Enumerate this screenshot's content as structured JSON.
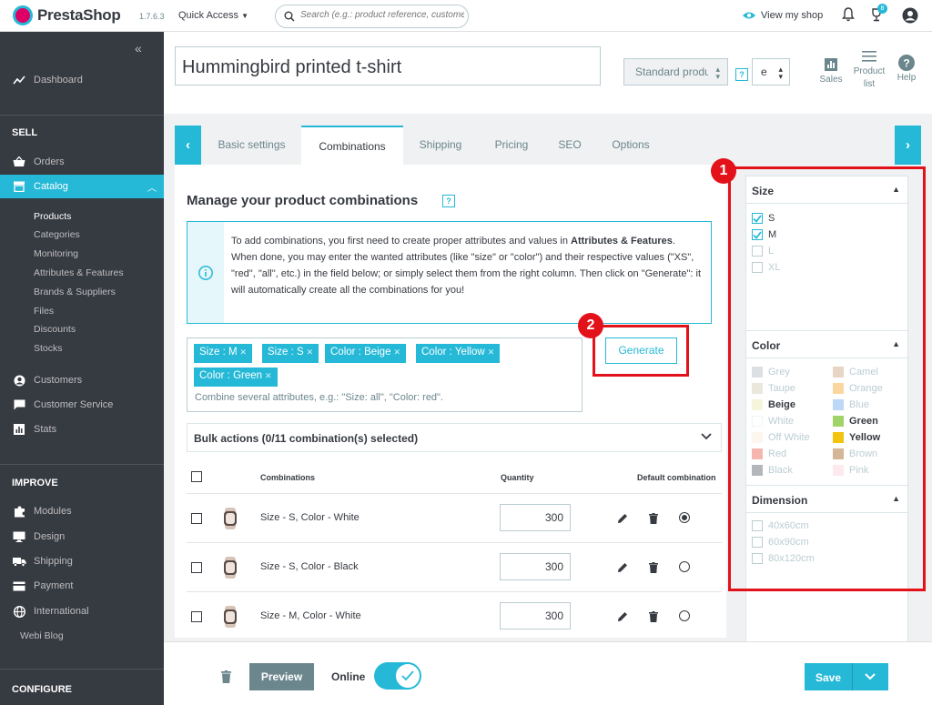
{
  "header": {
    "logo_text": "PrestaShop",
    "version": "1.7.6.3",
    "quick_access": "Quick Access",
    "search_placeholder": "Search (e.g.: product reference, customer name…)",
    "view_shop": "View my shop",
    "notification_count": "8"
  },
  "sidebar": {
    "dashboard": "Dashboard",
    "section_sell": "SELL",
    "orders": "Orders",
    "catalog": "Catalog",
    "catalog_sub": [
      "Products",
      "Categories",
      "Monitoring",
      "Attributes & Features",
      "Brands & Suppliers",
      "Files",
      "Discounts",
      "Stocks"
    ],
    "customers": "Customers",
    "customer_service": "Customer Service",
    "stats": "Stats",
    "section_improve": "IMPROVE",
    "modules": "Modules",
    "design": "Design",
    "shipping": "Shipping",
    "payment": "Payment",
    "international": "International",
    "webi_blog": "Webi Blog",
    "section_configure": "CONFIGURE"
  },
  "toolbar": {
    "product_name": "Hummingbird printed t-shirt",
    "product_type": "Standard product",
    "lang": "e",
    "sales": "Sales",
    "product_list_1": "Product",
    "product_list_2": "list",
    "help": "Help",
    "help_mark": "?"
  },
  "tabs": [
    "Basic settings",
    "Combinations",
    "Shipping",
    "Pricing",
    "SEO",
    "Options"
  ],
  "combinations": {
    "title": "Manage your product combinations",
    "info_line1_a": "To add combinations, you first need to create proper attributes and values in ",
    "info_line1_b": "Attributes & Features",
    "info_line1_c": ".",
    "info_line2": "When done, you may enter the wanted attributes (like \"size\" or \"color\") and their respective values (\"XS\", \"red\", \"all\", etc.) in the field below; or simply select them from the right column. Then click on \"Generate\": it will automatically create all the combinations for you!",
    "tags": [
      "Size : M",
      "Size : S",
      "Color : Beige",
      "Color : Yellow",
      "Color : Green"
    ],
    "tag_placeholder": "Combine several attributes, e.g.: \"Size: all\", \"Color: red\".",
    "generate": "Generate",
    "bulk": "Bulk actions (0/11 combination(s) selected)",
    "col_combinations": "Combinations",
    "col_quantity": "Quantity",
    "col_default": "Default combination",
    "rows": [
      {
        "name": "Size - S, Color - White",
        "qty": "300"
      },
      {
        "name": "Size - S, Color - Black",
        "qty": "300"
      },
      {
        "name": "Size - M, Color - White",
        "qty": "300"
      }
    ]
  },
  "filters": {
    "size_title": "Size",
    "sizes": [
      {
        "label": "S",
        "checked": true
      },
      {
        "label": "M",
        "checked": true
      },
      {
        "label": "L",
        "checked": false
      },
      {
        "label": "XL",
        "checked": false
      }
    ],
    "color_title": "Color",
    "colors_left": [
      {
        "label": "Grey",
        "hex": "#aab2bd",
        "selected": false
      },
      {
        "label": "Taupe",
        "hex": "#cfc4a6",
        "selected": false
      },
      {
        "label": "Beige",
        "hex": "#f5f5dc",
        "selected": true
      },
      {
        "label": "White",
        "hex": "#ffffff",
        "selected": false
      },
      {
        "label": "Off White",
        "hex": "#faebd7",
        "selected": false
      },
      {
        "label": "Red",
        "hex": "#e84c3d",
        "selected": false
      },
      {
        "label": "Black",
        "hex": "#434a54",
        "selected": false
      }
    ],
    "colors_right": [
      {
        "label": "Camel",
        "hex": "#c19a6b",
        "selected": false
      },
      {
        "label": "Orange",
        "hex": "#f39c11",
        "selected": false
      },
      {
        "label": "Blue",
        "hex": "#5d9cec",
        "selected": false
      },
      {
        "label": "Green",
        "hex": "#a0d468",
        "selected": true
      },
      {
        "label": "Yellow",
        "hex": "#f1c40f",
        "selected": true
      },
      {
        "label": "Brown",
        "hex": "#964b00",
        "selected": false
      },
      {
        "label": "Pink",
        "hex": "#fcccd9",
        "selected": false
      }
    ],
    "dimension_title": "Dimension",
    "dimensions": [
      "40x60cm",
      "60x90cm",
      "80x120cm"
    ]
  },
  "annotations": {
    "badge1": "1",
    "badge2": "2"
  },
  "footer": {
    "preview": "Preview",
    "online": "Online",
    "save": "Save"
  },
  "colors": {
    "accent": "#25b9d7",
    "sidebar": "#363a41",
    "annotation": "#e3111a"
  }
}
